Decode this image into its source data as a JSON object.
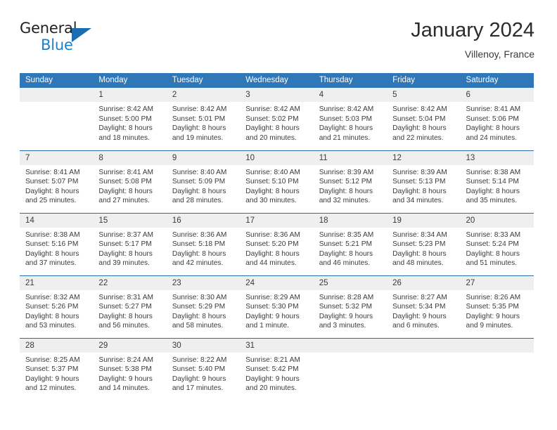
{
  "brand": {
    "word_one": "General",
    "word_two": "Blue",
    "logo_icon": "triangle-logo-icon"
  },
  "header": {
    "title": "January 2024",
    "location": "Villenoy, France"
  },
  "colors": {
    "header_blue": "#3077b8",
    "row_divider_blue": "#2d6ca8",
    "daynum_band": "#efefef",
    "brand_blue": "#1f7fc4",
    "text": "#3b3b3b"
  },
  "weekday_headers": [
    "Sunday",
    "Monday",
    "Tuesday",
    "Wednesday",
    "Thursday",
    "Friday",
    "Saturday"
  ],
  "weeks": [
    [
      {
        "day": "",
        "sunrise": "",
        "sunset": "",
        "daylight_l1": "",
        "daylight_l2": ""
      },
      {
        "day": "1",
        "sunrise": "Sunrise: 8:42 AM",
        "sunset": "Sunset: 5:00 PM",
        "daylight_l1": "Daylight: 8 hours",
        "daylight_l2": "and 18 minutes."
      },
      {
        "day": "2",
        "sunrise": "Sunrise: 8:42 AM",
        "sunset": "Sunset: 5:01 PM",
        "daylight_l1": "Daylight: 8 hours",
        "daylight_l2": "and 19 minutes."
      },
      {
        "day": "3",
        "sunrise": "Sunrise: 8:42 AM",
        "sunset": "Sunset: 5:02 PM",
        "daylight_l1": "Daylight: 8 hours",
        "daylight_l2": "and 20 minutes."
      },
      {
        "day": "4",
        "sunrise": "Sunrise: 8:42 AM",
        "sunset": "Sunset: 5:03 PM",
        "daylight_l1": "Daylight: 8 hours",
        "daylight_l2": "and 21 minutes."
      },
      {
        "day": "5",
        "sunrise": "Sunrise: 8:42 AM",
        "sunset": "Sunset: 5:04 PM",
        "daylight_l1": "Daylight: 8 hours",
        "daylight_l2": "and 22 minutes."
      },
      {
        "day": "6",
        "sunrise": "Sunrise: 8:41 AM",
        "sunset": "Sunset: 5:06 PM",
        "daylight_l1": "Daylight: 8 hours",
        "daylight_l2": "and 24 minutes."
      }
    ],
    [
      {
        "day": "7",
        "sunrise": "Sunrise: 8:41 AM",
        "sunset": "Sunset: 5:07 PM",
        "daylight_l1": "Daylight: 8 hours",
        "daylight_l2": "and 25 minutes."
      },
      {
        "day": "8",
        "sunrise": "Sunrise: 8:41 AM",
        "sunset": "Sunset: 5:08 PM",
        "daylight_l1": "Daylight: 8 hours",
        "daylight_l2": "and 27 minutes."
      },
      {
        "day": "9",
        "sunrise": "Sunrise: 8:40 AM",
        "sunset": "Sunset: 5:09 PM",
        "daylight_l1": "Daylight: 8 hours",
        "daylight_l2": "and 28 minutes."
      },
      {
        "day": "10",
        "sunrise": "Sunrise: 8:40 AM",
        "sunset": "Sunset: 5:10 PM",
        "daylight_l1": "Daylight: 8 hours",
        "daylight_l2": "and 30 minutes."
      },
      {
        "day": "11",
        "sunrise": "Sunrise: 8:39 AM",
        "sunset": "Sunset: 5:12 PM",
        "daylight_l1": "Daylight: 8 hours",
        "daylight_l2": "and 32 minutes."
      },
      {
        "day": "12",
        "sunrise": "Sunrise: 8:39 AM",
        "sunset": "Sunset: 5:13 PM",
        "daylight_l1": "Daylight: 8 hours",
        "daylight_l2": "and 34 minutes."
      },
      {
        "day": "13",
        "sunrise": "Sunrise: 8:38 AM",
        "sunset": "Sunset: 5:14 PM",
        "daylight_l1": "Daylight: 8 hours",
        "daylight_l2": "and 35 minutes."
      }
    ],
    [
      {
        "day": "14",
        "sunrise": "Sunrise: 8:38 AM",
        "sunset": "Sunset: 5:16 PM",
        "daylight_l1": "Daylight: 8 hours",
        "daylight_l2": "and 37 minutes."
      },
      {
        "day": "15",
        "sunrise": "Sunrise: 8:37 AM",
        "sunset": "Sunset: 5:17 PM",
        "daylight_l1": "Daylight: 8 hours",
        "daylight_l2": "and 39 minutes."
      },
      {
        "day": "16",
        "sunrise": "Sunrise: 8:36 AM",
        "sunset": "Sunset: 5:18 PM",
        "daylight_l1": "Daylight: 8 hours",
        "daylight_l2": "and 42 minutes."
      },
      {
        "day": "17",
        "sunrise": "Sunrise: 8:36 AM",
        "sunset": "Sunset: 5:20 PM",
        "daylight_l1": "Daylight: 8 hours",
        "daylight_l2": "and 44 minutes."
      },
      {
        "day": "18",
        "sunrise": "Sunrise: 8:35 AM",
        "sunset": "Sunset: 5:21 PM",
        "daylight_l1": "Daylight: 8 hours",
        "daylight_l2": "and 46 minutes."
      },
      {
        "day": "19",
        "sunrise": "Sunrise: 8:34 AM",
        "sunset": "Sunset: 5:23 PM",
        "daylight_l1": "Daylight: 8 hours",
        "daylight_l2": "and 48 minutes."
      },
      {
        "day": "20",
        "sunrise": "Sunrise: 8:33 AM",
        "sunset": "Sunset: 5:24 PM",
        "daylight_l1": "Daylight: 8 hours",
        "daylight_l2": "and 51 minutes."
      }
    ],
    [
      {
        "day": "21",
        "sunrise": "Sunrise: 8:32 AM",
        "sunset": "Sunset: 5:26 PM",
        "daylight_l1": "Daylight: 8 hours",
        "daylight_l2": "and 53 minutes."
      },
      {
        "day": "22",
        "sunrise": "Sunrise: 8:31 AM",
        "sunset": "Sunset: 5:27 PM",
        "daylight_l1": "Daylight: 8 hours",
        "daylight_l2": "and 56 minutes."
      },
      {
        "day": "23",
        "sunrise": "Sunrise: 8:30 AM",
        "sunset": "Sunset: 5:29 PM",
        "daylight_l1": "Daylight: 8 hours",
        "daylight_l2": "and 58 minutes."
      },
      {
        "day": "24",
        "sunrise": "Sunrise: 8:29 AM",
        "sunset": "Sunset: 5:30 PM",
        "daylight_l1": "Daylight: 9 hours",
        "daylight_l2": "and 1 minute."
      },
      {
        "day": "25",
        "sunrise": "Sunrise: 8:28 AM",
        "sunset": "Sunset: 5:32 PM",
        "daylight_l1": "Daylight: 9 hours",
        "daylight_l2": "and 3 minutes."
      },
      {
        "day": "26",
        "sunrise": "Sunrise: 8:27 AM",
        "sunset": "Sunset: 5:34 PM",
        "daylight_l1": "Daylight: 9 hours",
        "daylight_l2": "and 6 minutes."
      },
      {
        "day": "27",
        "sunrise": "Sunrise: 8:26 AM",
        "sunset": "Sunset: 5:35 PM",
        "daylight_l1": "Daylight: 9 hours",
        "daylight_l2": "and 9 minutes."
      }
    ],
    [
      {
        "day": "28",
        "sunrise": "Sunrise: 8:25 AM",
        "sunset": "Sunset: 5:37 PM",
        "daylight_l1": "Daylight: 9 hours",
        "daylight_l2": "and 12 minutes."
      },
      {
        "day": "29",
        "sunrise": "Sunrise: 8:24 AM",
        "sunset": "Sunset: 5:38 PM",
        "daylight_l1": "Daylight: 9 hours",
        "daylight_l2": "and 14 minutes."
      },
      {
        "day": "30",
        "sunrise": "Sunrise: 8:22 AM",
        "sunset": "Sunset: 5:40 PM",
        "daylight_l1": "Daylight: 9 hours",
        "daylight_l2": "and 17 minutes."
      },
      {
        "day": "31",
        "sunrise": "Sunrise: 8:21 AM",
        "sunset": "Sunset: 5:42 PM",
        "daylight_l1": "Daylight: 9 hours",
        "daylight_l2": "and 20 minutes."
      },
      {
        "day": "",
        "sunrise": "",
        "sunset": "",
        "daylight_l1": "",
        "daylight_l2": ""
      },
      {
        "day": "",
        "sunrise": "",
        "sunset": "",
        "daylight_l1": "",
        "daylight_l2": ""
      },
      {
        "day": "",
        "sunrise": "",
        "sunset": "",
        "daylight_l1": "",
        "daylight_l2": ""
      }
    ]
  ]
}
